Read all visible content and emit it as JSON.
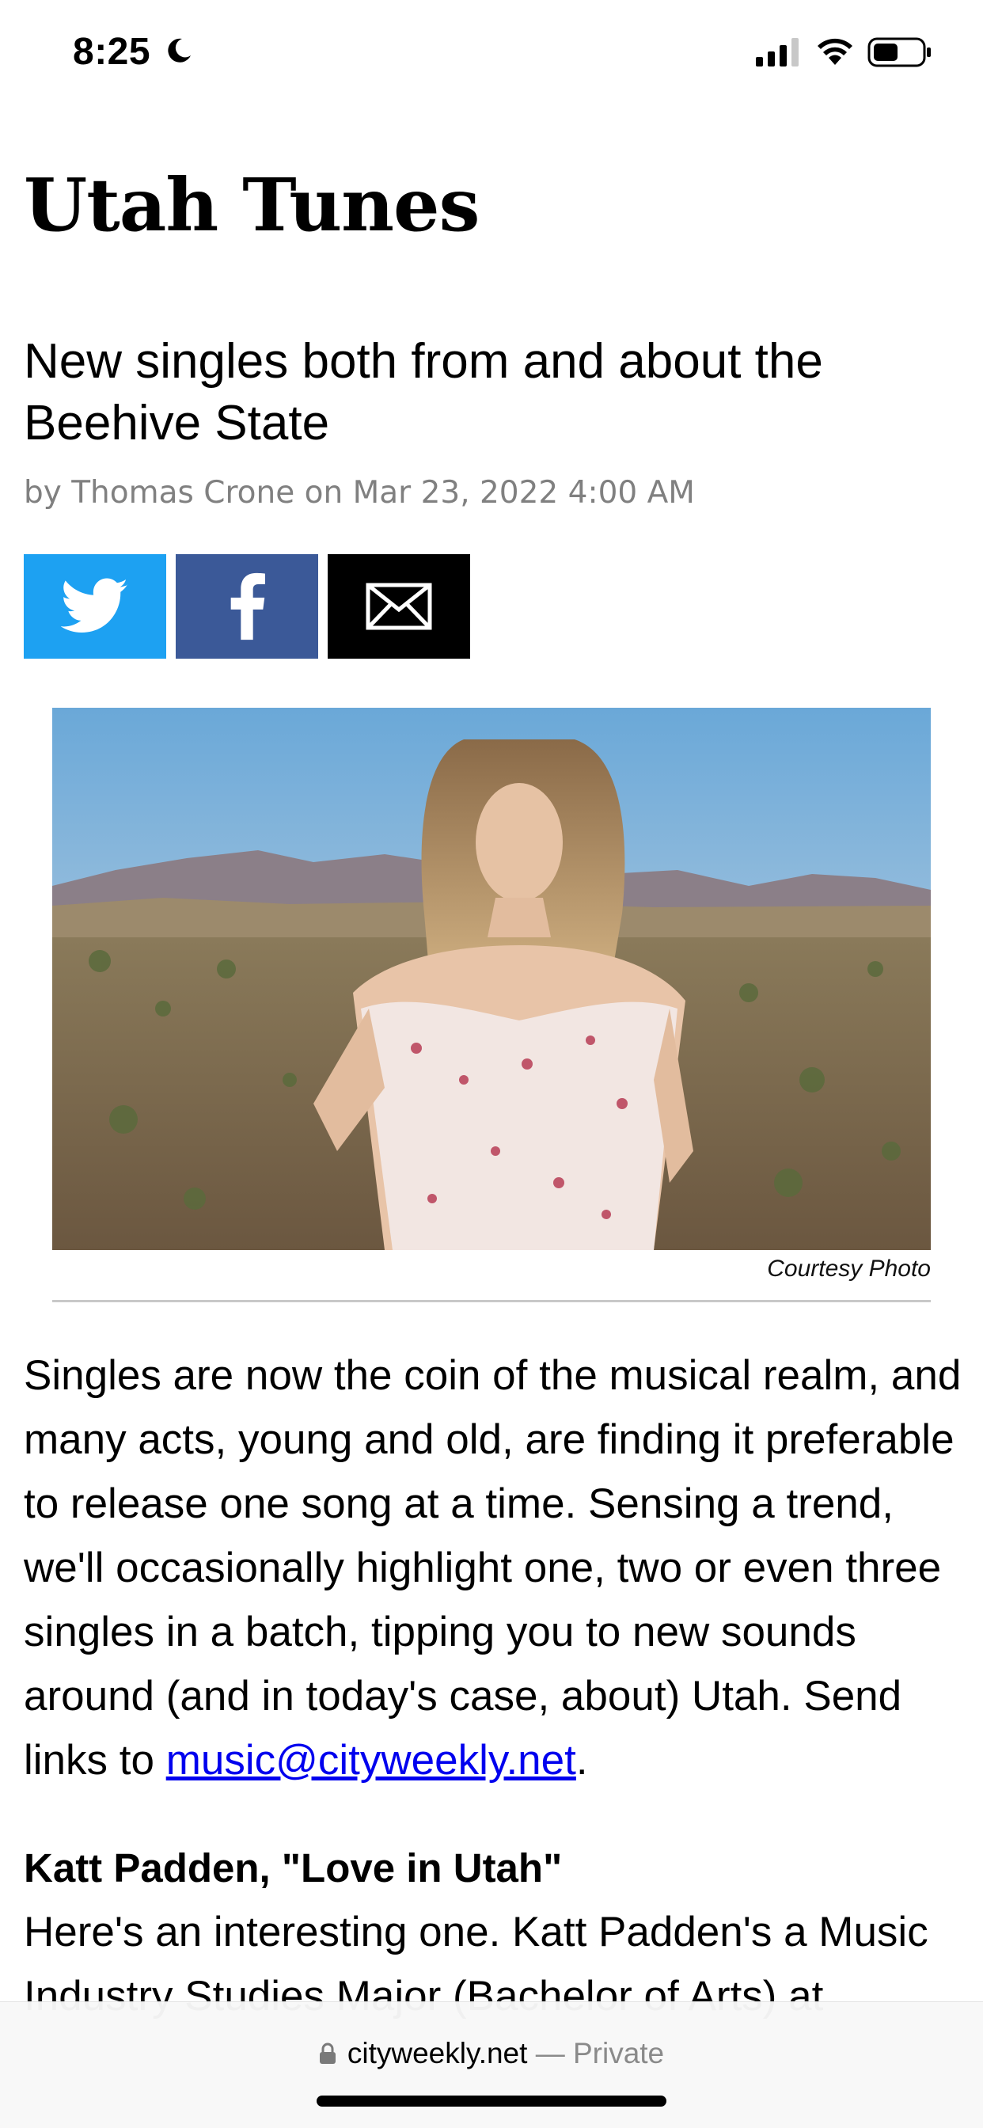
{
  "status": {
    "time": "8:25",
    "icons": [
      "moon-icon",
      "cellular-signal-icon",
      "wifi-icon",
      "battery-icon"
    ]
  },
  "article": {
    "title": "Utah Tunes",
    "subtitle": "New singles both from and about the Beehive State",
    "byline": "by Thomas Crone on Mar 23, 2022 4:00 AM",
    "share": [
      {
        "icon": "twitter-icon",
        "color": "#1da1f2"
      },
      {
        "icon": "facebook-icon",
        "color": "#3b5998"
      },
      {
        "icon": "email-icon",
        "color": "#000000"
      }
    ],
    "photo_caption": "Courtesy Photo",
    "intro_text": "Singles are now the coin of the musical realm, and many acts, young and old, are finding it preferable to release one song at a time. Sensing a trend, we'll occasionally highlight one, two or even three singles in a batch, tipping you to new sounds around (and in today's case, about) Utah. Send links to",
    "email_link": "music@cityweekly.net",
    "intro_end": ".",
    "section_title": "Katt Padden, \"Love in Utah\"",
    "section_text": "Here's an interesting one. Katt Padden's a Music Industry Studies Major (Bachelor of Arts) at"
  },
  "browser": {
    "url": "cityweekly.net",
    "separator": " — ",
    "mode": "Private"
  },
  "colors": {
    "link": "#0000ee",
    "byline": "#808080",
    "twitter": "#1da1f2",
    "facebook": "#3b5998"
  }
}
